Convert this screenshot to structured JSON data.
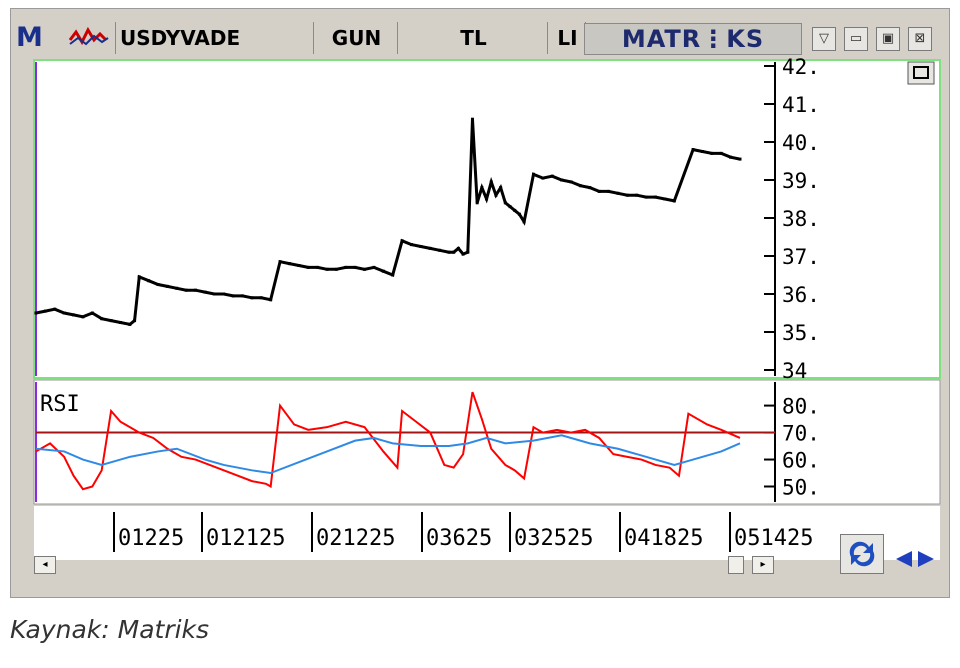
{
  "window": {
    "symbol": "USDYVADE",
    "period": "GUN",
    "currency": "TL",
    "col4": "LI",
    "brand": "MATR⋮KS",
    "logo": "M",
    "minimize_icon": "▽",
    "restore_icon": "▭",
    "max_icon": "▣",
    "close_icon": "⊠"
  },
  "caption": "Kaynak: Matriks",
  "chart_data": [
    {
      "type": "line",
      "panel": "price",
      "x_tick_labels": [
        "01225",
        "012125",
        "021225",
        "03625",
        "032525",
        "041825",
        "051425"
      ],
      "y_tick_labels": [
        "42.",
        "41.",
        "40.",
        "39.",
        "38.",
        "37.",
        "36.",
        "35.",
        "34"
      ],
      "ylim": [
        34,
        42
      ],
      "series": [
        {
          "x": [
            0,
            2,
            4,
            6,
            8,
            10,
            12,
            14,
            16,
            18,
            20,
            21,
            22,
            24,
            26,
            28,
            30,
            32,
            34,
            36,
            38,
            40,
            42,
            44,
            46,
            48,
            50,
            52,
            54,
            56,
            58,
            60,
            62,
            64,
            66,
            68,
            70,
            72,
            74,
            76,
            78,
            80,
            82,
            84,
            86,
            88,
            89,
            90,
            91,
            92,
            93,
            94,
            95,
            96,
            97,
            98,
            99,
            100,
            101,
            102,
            103,
            104,
            106,
            108,
            110,
            112,
            114,
            116,
            118,
            120,
            122,
            124,
            126,
            128,
            130,
            132,
            134,
            136,
            140,
            142,
            144,
            146,
            148,
            150
          ],
          "y": [
            35.5,
            35.55,
            35.6,
            35.5,
            35.45,
            35.4,
            35.5,
            35.35,
            35.3,
            35.25,
            35.2,
            35.3,
            36.45,
            36.35,
            36.25,
            36.2,
            36.15,
            36.1,
            36.1,
            36.05,
            36.0,
            36.0,
            35.95,
            35.95,
            35.9,
            35.9,
            35.85,
            36.85,
            36.8,
            36.75,
            36.7,
            36.7,
            36.65,
            36.65,
            36.7,
            36.7,
            36.65,
            36.7,
            36.6,
            36.5,
            37.4,
            37.3,
            37.25,
            37.2,
            37.15,
            37.1,
            37.1,
            37.2,
            37.05,
            37.1,
            40.6,
            38.4,
            38.8,
            38.5,
            38.95,
            38.6,
            38.8,
            38.4,
            38.3,
            38.2,
            38.1,
            37.9,
            39.15,
            39.05,
            39.1,
            39.0,
            38.95,
            38.85,
            38.8,
            38.7,
            38.7,
            38.65,
            38.6,
            38.6,
            38.55,
            38.55,
            38.5,
            38.45,
            39.8,
            39.75,
            39.7,
            39.7,
            39.6,
            39.55
          ]
        }
      ]
    },
    {
      "type": "line",
      "panel": "rsi",
      "title": "RSI",
      "y_tick_labels": [
        "80.",
        "70.",
        "60.",
        "50."
      ],
      "ylim": [
        45,
        88
      ],
      "reference_line": 70,
      "series": [
        {
          "color": "#ff0000",
          "x": [
            0,
            3,
            6,
            8,
            10,
            12,
            14,
            16,
            18,
            20,
            22,
            25,
            28,
            31,
            34,
            37,
            40,
            43,
            46,
            49,
            50,
            52,
            55,
            58,
            62,
            66,
            70,
            74,
            77,
            78,
            81,
            84,
            87,
            89,
            91,
            93,
            95,
            97,
            100,
            102,
            104,
            106,
            108,
            111,
            114,
            117,
            120,
            123,
            126,
            129,
            132,
            135,
            137,
            139,
            143,
            146,
            150
          ],
          "y": [
            63,
            66,
            61,
            54,
            49,
            50,
            56,
            78,
            74,
            72,
            70,
            68,
            64,
            61,
            60,
            58,
            56,
            54,
            52,
            51,
            50,
            80,
            73,
            71,
            72,
            74,
            72,
            63,
            57,
            78,
            74,
            70,
            58,
            57,
            62,
            85,
            75,
            64,
            58,
            56,
            53,
            72,
            70,
            71,
            70,
            71,
            68,
            62,
            61,
            60,
            58,
            57,
            54,
            77,
            73,
            71,
            68
          ]
        },
        {
          "color": "#2f8ae6",
          "x": [
            0,
            6,
            10,
            14,
            20,
            26,
            30,
            36,
            40,
            46,
            50,
            56,
            62,
            68,
            72,
            76,
            82,
            88,
            92,
            96,
            100,
            106,
            112,
            118,
            124,
            130,
            136,
            140,
            146,
            150
          ],
          "y": [
            64,
            63,
            60,
            58,
            61,
            63,
            64,
            60,
            58,
            56,
            55,
            59,
            63,
            67,
            68,
            66,
            65,
            65,
            66,
            68,
            66,
            67,
            69,
            66,
            64,
            61,
            58,
            60,
            63,
            66
          ]
        }
      ]
    }
  ]
}
